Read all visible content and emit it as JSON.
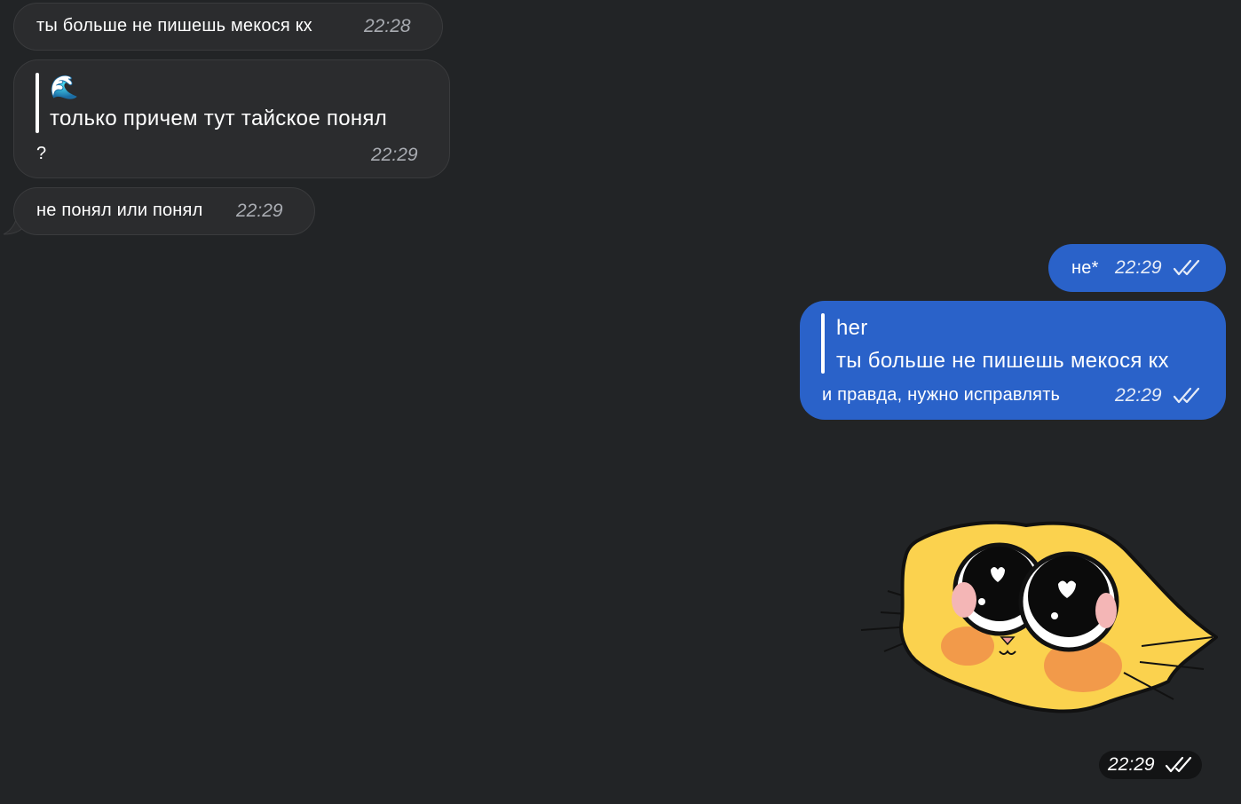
{
  "messages": {
    "m1": {
      "text": "ты больше не пишешь мекося кх",
      "time": "22:28"
    },
    "m2": {
      "quote_emoji": "🌊",
      "quote_text": "только причем тут тайское понял",
      "text": "?",
      "time": "22:29"
    },
    "m3": {
      "text": "не понял или понял",
      "time": "22:29"
    },
    "m4": {
      "text": "не*",
      "time": "22:29"
    },
    "m5": {
      "quote_author": "her",
      "quote_text": "ты больше не пишешь мекося кх",
      "text": "и правда, нужно исправлять",
      "time": "22:29"
    },
    "sticker": {
      "icon": "yellow-cat-sticker",
      "time": "22:29"
    }
  },
  "colors": {
    "background": "#222426",
    "incoming_bubble": "#2b2c2e",
    "outgoing_bubble": "#2a62c9"
  }
}
